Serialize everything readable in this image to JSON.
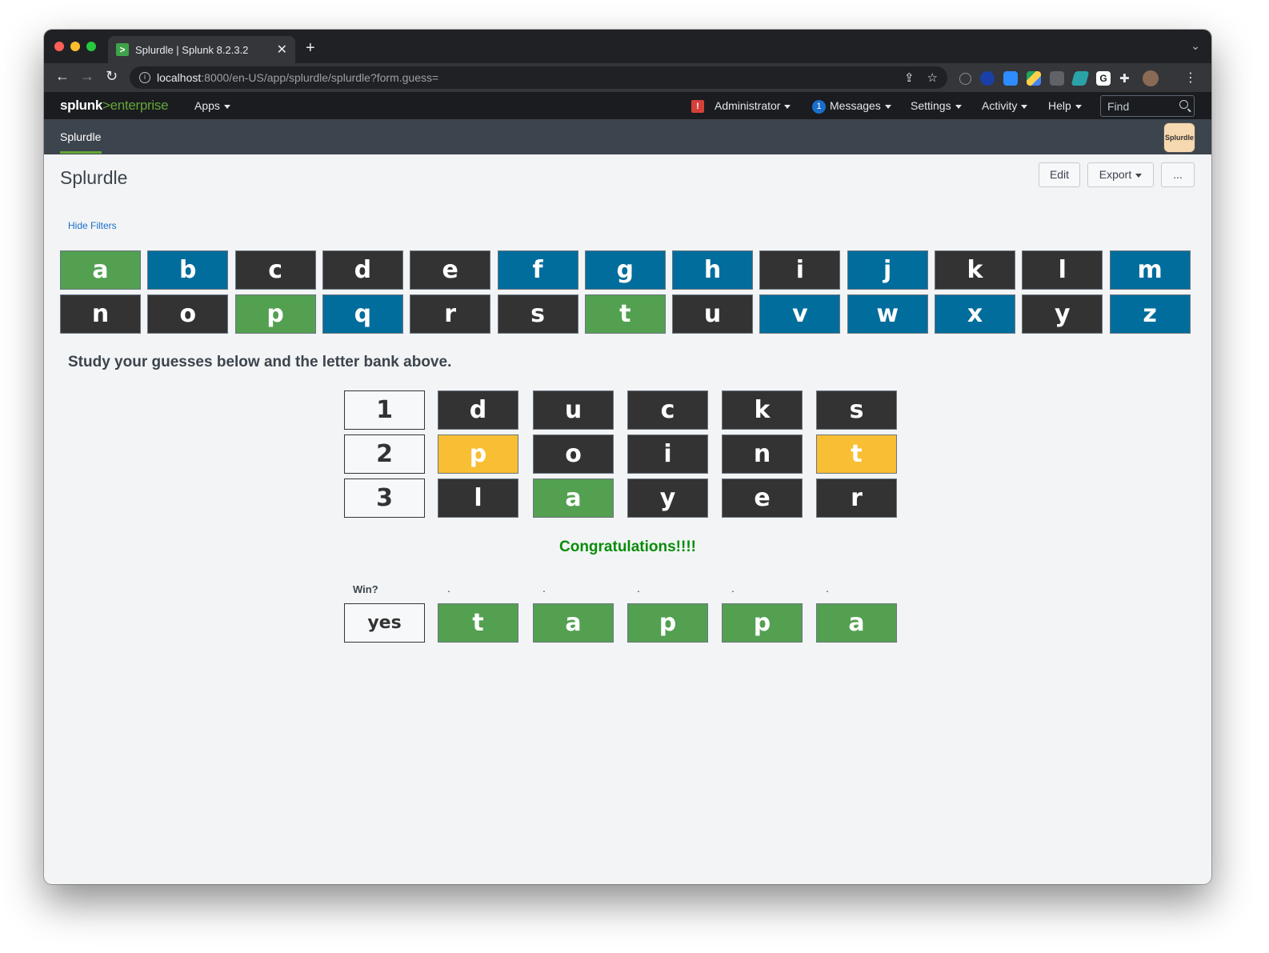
{
  "browser": {
    "tab_title": "Splurdle | Splunk 8.2.3.2",
    "url_host": "localhost",
    "url_rest": ":8000/en-US/app/splurdle/splurdle?form.guess="
  },
  "splunkbar": {
    "logo_main": "splunk",
    "logo_gt": ">",
    "logo_product": "enterprise",
    "apps": "Apps",
    "alert_badge": "!",
    "admin": "Administrator",
    "messages_count": "1",
    "messages": "Messages",
    "settings": "Settings",
    "activity": "Activity",
    "help": "Help",
    "find_placeholder": "Find"
  },
  "appbar": {
    "tab": "Splurdle",
    "logo": "Splurdle"
  },
  "dashboard": {
    "title": "Splurdle",
    "edit": "Edit",
    "export": "Export",
    "more": "...",
    "hide_filters": "Hide Filters",
    "study_text": "Study your guesses below and the letter bank above.",
    "congrats": "Congratulations!!!!"
  },
  "colors": {
    "correct": "#53a051",
    "unused": "#006d9c",
    "absent": "#333333",
    "present": "#f8be34"
  },
  "letter_bank": [
    [
      {
        "l": "a",
        "s": "g"
      },
      {
        "l": "b",
        "s": "b"
      },
      {
        "l": "c",
        "s": "k"
      },
      {
        "l": "d",
        "s": "k"
      },
      {
        "l": "e",
        "s": "k"
      },
      {
        "l": "f",
        "s": "b"
      },
      {
        "l": "g",
        "s": "b"
      },
      {
        "l": "h",
        "s": "b"
      },
      {
        "l": "i",
        "s": "k"
      },
      {
        "l": "j",
        "s": "b"
      },
      {
        "l": "k",
        "s": "k"
      },
      {
        "l": "l",
        "s": "k"
      },
      {
        "l": "m",
        "s": "b"
      }
    ],
    [
      {
        "l": "n",
        "s": "k"
      },
      {
        "l": "o",
        "s": "k"
      },
      {
        "l": "p",
        "s": "g"
      },
      {
        "l": "q",
        "s": "b"
      },
      {
        "l": "r",
        "s": "k"
      },
      {
        "l": "s",
        "s": "k"
      },
      {
        "l": "t",
        "s": "g"
      },
      {
        "l": "u",
        "s": "k"
      },
      {
        "l": "v",
        "s": "b"
      },
      {
        "l": "w",
        "s": "b"
      },
      {
        "l": "x",
        "s": "b"
      },
      {
        "l": "y",
        "s": "k"
      },
      {
        "l": "z",
        "s": "b"
      }
    ]
  ],
  "guesses": [
    {
      "num": "1",
      "letters": [
        {
          "l": "d",
          "s": "k"
        },
        {
          "l": "u",
          "s": "k"
        },
        {
          "l": "c",
          "s": "k"
        },
        {
          "l": "k",
          "s": "k"
        },
        {
          "l": "s",
          "s": "k"
        }
      ]
    },
    {
      "num": "2",
      "letters": [
        {
          "l": "p",
          "s": "y"
        },
        {
          "l": "o",
          "s": "k"
        },
        {
          "l": "i",
          "s": "k"
        },
        {
          "l": "n",
          "s": "k"
        },
        {
          "l": "t",
          "s": "y"
        }
      ]
    },
    {
      "num": "3",
      "letters": [
        {
          "l": "l",
          "s": "k"
        },
        {
          "l": "a",
          "s": "g"
        },
        {
          "l": "y",
          "s": "k"
        },
        {
          "l": "e",
          "s": "k"
        },
        {
          "l": "r",
          "s": "k"
        }
      ]
    }
  ],
  "result": {
    "win_label": "Win?",
    "col_labels": [
      ".",
      ".",
      ".",
      ".",
      "."
    ],
    "win_value": "yes",
    "letters": [
      "t",
      "a",
      "p",
      "p",
      "a"
    ]
  }
}
